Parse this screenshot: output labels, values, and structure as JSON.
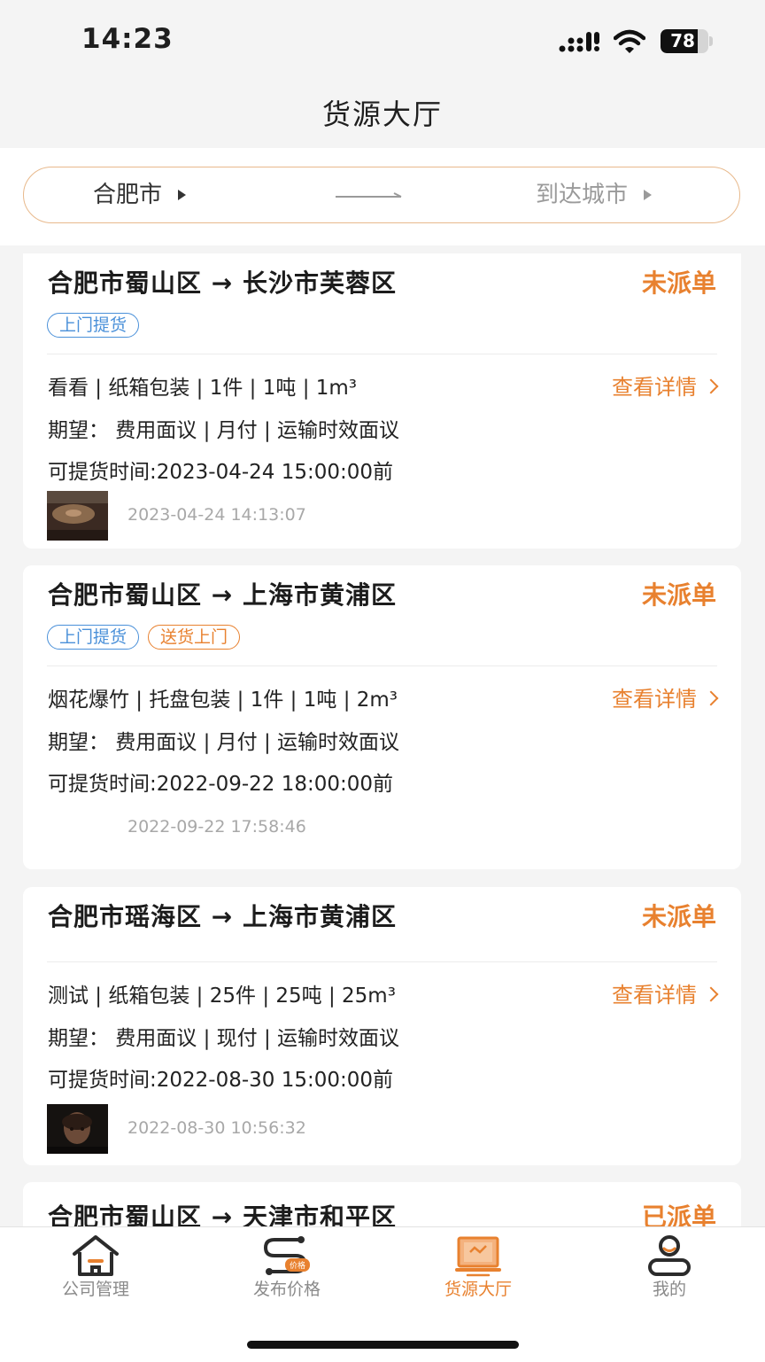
{
  "status_bar": {
    "time": "14:23",
    "battery_percent": 78,
    "battery_level": 0.78
  },
  "nav": {
    "title": "货源大厅"
  },
  "filter": {
    "from_city": "合肥市",
    "to_city": "到达城市"
  },
  "listings": [
    {
      "route": "合肥市蜀山区 → 长沙市芙蓉区",
      "status": "未派单",
      "tags": [
        "上门提货"
      ],
      "cargo": "看看 | 纸箱包装 | 1件 | 1吨 | 1m³",
      "expectation": "期望： 费用面议 | 月付 | 运输时效面议",
      "pickup_time": "可提货时间:2023-04-24 15:00:00前",
      "details_label": "查看详情",
      "posted_at": "2023-04-24 14:13:07"
    },
    {
      "route": "合肥市蜀山区 → 上海市黄浦区",
      "status": "未派单",
      "tags": [
        "上门提货",
        "送货上门"
      ],
      "cargo": "烟花爆竹 | 托盘包装 | 1件 | 1吨 | 2m³",
      "expectation": "期望： 费用面议 | 月付 | 运输时效面议",
      "pickup_time": "可提货时间:2022-09-22 18:00:00前",
      "details_label": "查看详情",
      "posted_at": "2022-09-22 17:58:46"
    },
    {
      "route": "合肥市瑶海区 → 上海市黄浦区",
      "status": "未派单",
      "tags": [],
      "cargo": "测试 | 纸箱包装 | 25件 | 25吨 | 25m³",
      "expectation": "期望： 费用面议 | 现付 | 运输时效面议",
      "pickup_time": "可提货时间:2022-08-30 15:00:00前",
      "details_label": "查看详情",
      "posted_at": "2022-08-30 10:56:32"
    },
    {
      "route": "合肥市蜀山区 → 天津市和平区",
      "status": "已派单"
    }
  ],
  "tabbar": {
    "items": [
      {
        "label": "公司管理",
        "icon": "home-icon"
      },
      {
        "label": "发布价格",
        "icon": "price-route-icon",
        "badge": "价格"
      },
      {
        "label": "货源大厅",
        "icon": "cargo-hall-icon",
        "active": true
      },
      {
        "label": "我的",
        "icon": "profile-icon"
      }
    ]
  },
  "colors": {
    "accent": "#e8812f",
    "tag_blue": "#4a90d9",
    "background": "#f4f4f4"
  }
}
